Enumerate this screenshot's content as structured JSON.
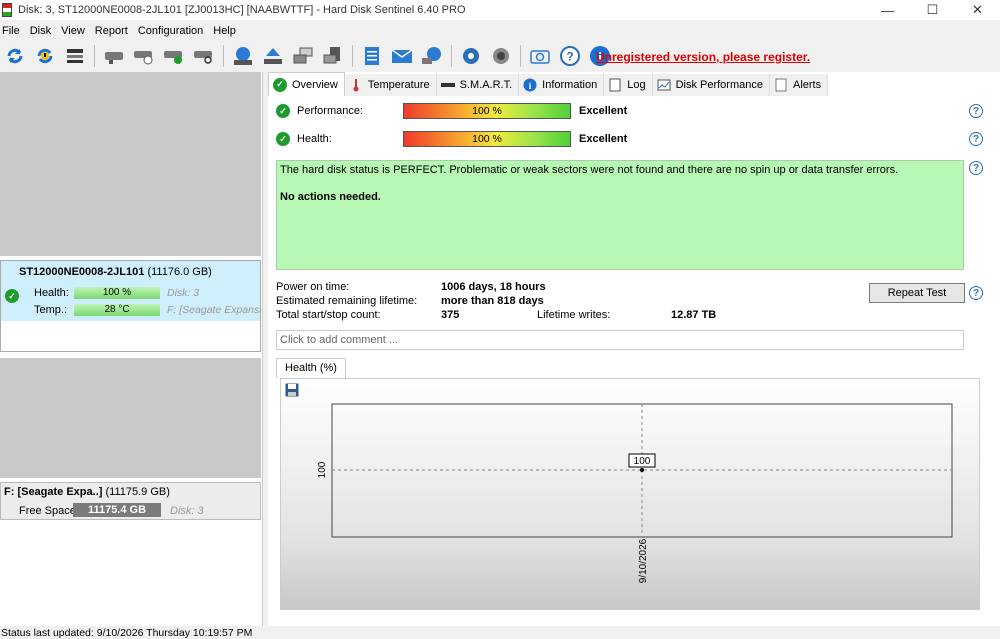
{
  "window": {
    "title": "Disk: 3, ST12000NE0008-2JL101 [ZJ0013HC]  [NAABWTTF]  -  Hard Disk Sentinel 6.40 PRO",
    "controls": [
      "—",
      "☐",
      "✕"
    ]
  },
  "menu": [
    "File",
    "Disk",
    "View",
    "Report",
    "Configuration",
    "Help"
  ],
  "toolbar": {
    "icons": [
      "refresh-icon",
      "refresh-warning-icon",
      "disk-list-icon",
      "drive-icon",
      "drive-clock-icon",
      "drive-check-icon",
      "drive-search-icon",
      "disk-globe-icon",
      "disk-eject-icon",
      "copy-drives-icon",
      "print-drive-icon",
      "notepad-icon",
      "mail-icon",
      "network-icon",
      "settings-gear-icon",
      "speaker-icon",
      "camera-icon",
      "help-icon",
      "info-icon"
    ],
    "unregistered": "Unregistered version, please register."
  },
  "left": {
    "disk": {
      "name": "ST12000NE0008-2JL101",
      "size": "(11176.0 GB)",
      "health_label": "Health:",
      "health_value": "100 %",
      "health_disk": "Disk: 3",
      "temp_label": "Temp.:",
      "temp_value": "28 °C",
      "temp_extra": "F: [Seagate Expansion]"
    },
    "volume": {
      "name": "F: [Seagate Expa..]",
      "size": "(11175.9 GB)",
      "free_label": "Free Space",
      "free_value": "11175.4 GB",
      "disk": "Disk: 3"
    }
  },
  "tabs": [
    {
      "label": "Overview",
      "icon": "check-icon"
    },
    {
      "label": "Temperature",
      "icon": "thermometer-icon"
    },
    {
      "label": "S.M.A.R.T.",
      "icon": "smart-icon"
    },
    {
      "label": "Information",
      "icon": "info-icon"
    },
    {
      "label": "Log",
      "icon": "log-icon"
    },
    {
      "label": "Disk Performance",
      "icon": "performance-icon"
    },
    {
      "label": "Alerts",
      "icon": "alerts-icon"
    }
  ],
  "overview": {
    "performance_label": "Performance:",
    "performance_value": "100 %",
    "performance_rating": "Excellent",
    "health_label": "Health:",
    "health_value": "100 %",
    "health_rating": "Excellent",
    "status_text": "The hard disk status is PERFECT. Problematic or weak sectors were not found and there are no spin up or data transfer errors.",
    "action_text": "No actions needed.",
    "power_on_label": "Power on time:",
    "power_on_value": "1006 days, 18 hours",
    "lifetime_label": "Estimated remaining lifetime:",
    "lifetime_value": "more than 818 days",
    "startstop_label": "Total start/stop count:",
    "startstop_value": "375",
    "writes_label": "Lifetime writes:",
    "writes_value": "12.87 TB",
    "repeat_button": "Repeat Test",
    "comment_placeholder": "Click to add comment ..."
  },
  "chart_tab": "Health (%)",
  "chart_data": {
    "type": "line",
    "x": [
      "9/10/2026"
    ],
    "series": [
      {
        "values": [
          100
        ]
      }
    ],
    "ylabel": "",
    "xlabel": "",
    "y_ticks": [
      "100"
    ],
    "point_label": "100"
  },
  "statusbar": "Status last updated: 9/10/2026 Thursday 10:19:57 PM"
}
